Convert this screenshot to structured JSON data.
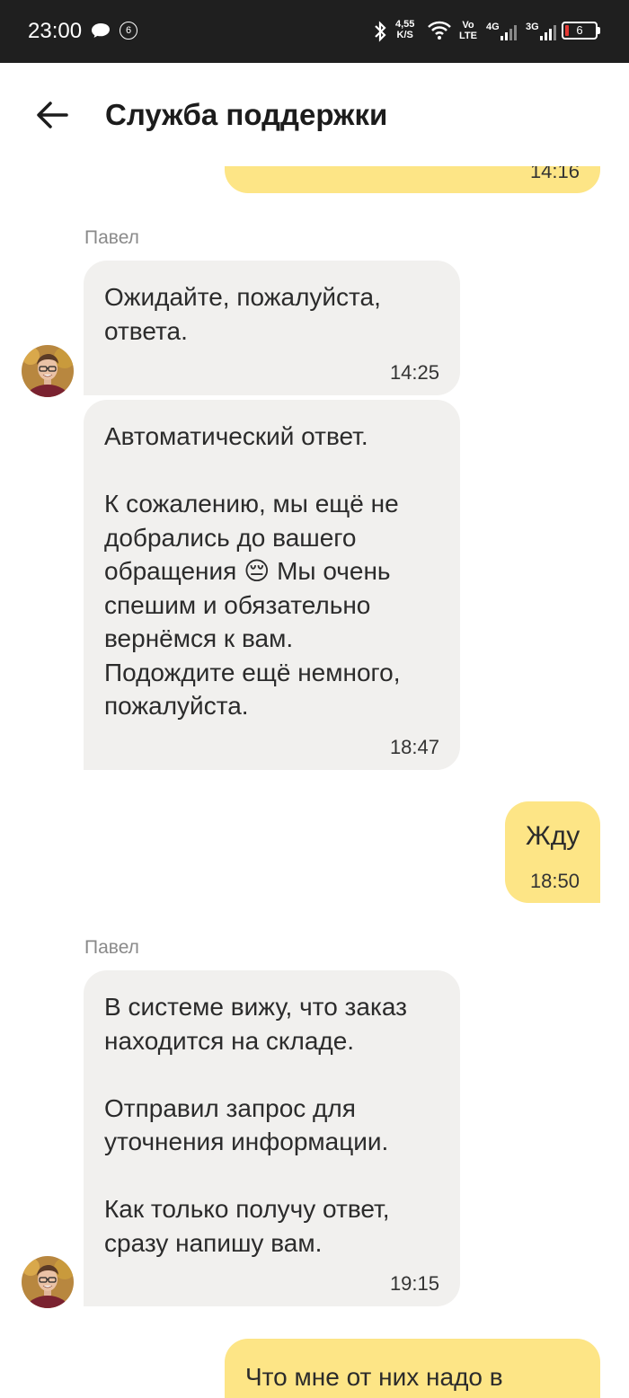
{
  "status_bar": {
    "time": "23:00",
    "notification_count": "6",
    "speed_value": "4,55",
    "speed_unit": "K/S",
    "volte_top": "Vo",
    "volte_bottom": "LTE",
    "net1": "4G",
    "net2": "3G",
    "battery_level": "6"
  },
  "header": {
    "title": "Служба поддержки"
  },
  "messages": [
    {
      "time": "14:16"
    },
    {
      "sender": "Павел",
      "text": "Ожидайте, пожалуйста,\nответа.",
      "time": "14:25"
    },
    {
      "text_line1": "Автоматический ответ.",
      "text_line2": "К сожалению, мы ещё не\nдобрались до вашего\nобращения",
      "emoji": "😔",
      "text_line3": " Мы очень\nспешим и обязательно\nвернёмся к вам.\nПодождите ещё немного,\nпожалуйста.",
      "time": "18:47"
    },
    {
      "text": "Жду",
      "time": "18:50"
    },
    {
      "sender": "Павел",
      "text": "В системе вижу, что заказ\nнаходится на складе.\n\nОтправил запрос для\nуточнения информации.\n\nКак только получу ответ,\nсразу напишу вам.",
      "time": "19:15"
    },
    {
      "text": "Что мне от них надо в"
    }
  ]
}
